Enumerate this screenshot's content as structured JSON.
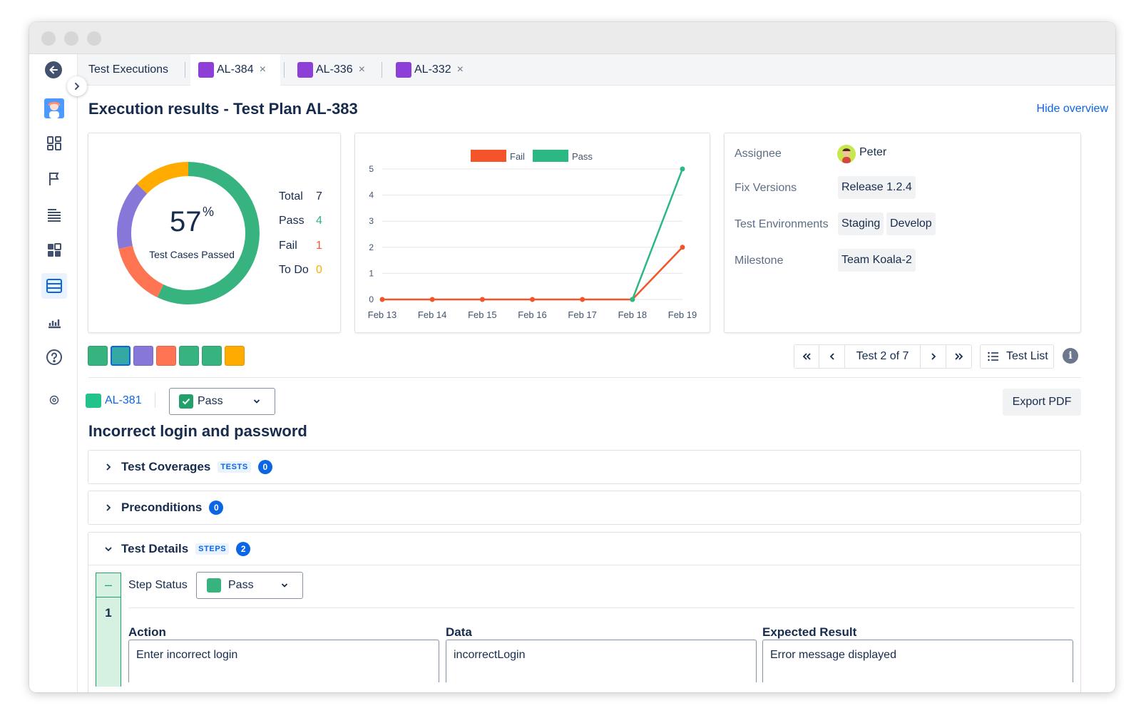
{
  "tabs": {
    "home": "Test Executions",
    "items": [
      {
        "label": "AL-384",
        "close": "×"
      },
      {
        "label": "AL-336",
        "close": "×"
      },
      {
        "label": "AL-332",
        "close": "×"
      }
    ]
  },
  "header": {
    "title": "Execution results - Test Plan AL-383",
    "hide_overview": "Hide overview"
  },
  "summary": {
    "percent": "57",
    "percent_sign": "%",
    "caption": "Test Cases Passed",
    "total_label": "Total",
    "total": "7",
    "pass_label": "Pass",
    "pass": "4",
    "fail_label": "Fail",
    "fail": "1",
    "todo_label": "To Do",
    "todo": "0",
    "colors": {
      "pass": "#36b37e",
      "fail": "#ff7452",
      "todo": "#ffab00",
      "other": "#8777d9"
    }
  },
  "chart_data": {
    "type": "line",
    "x": [
      "Feb 13",
      "Feb 14",
      "Feb 15",
      "Feb 16",
      "Feb 17",
      "Feb 18",
      "Feb 19"
    ],
    "series": [
      {
        "name": "Fail",
        "color": "#f4542a",
        "values": [
          0,
          0,
          0,
          0,
          0,
          0,
          2
        ]
      },
      {
        "name": "Pass",
        "color": "#2bb883",
        "values": [
          null,
          null,
          null,
          null,
          null,
          0,
          5
        ]
      }
    ],
    "ylim": [
      0,
      5
    ],
    "yticks": [
      "0",
      "1",
      "2",
      "3",
      "4",
      "5"
    ],
    "legend": "top",
    "grid": true
  },
  "meta": {
    "assignee_label": "Assignee",
    "assignee": "Peter",
    "fix_versions_label": "Fix Versions",
    "fix_version": "Release 1.2.4",
    "environments_label": "Test Environments",
    "environments": [
      "Staging",
      "Develop"
    ],
    "milestone_label": "Milestone",
    "milestone": "Team Koala-2"
  },
  "run_swatches": [
    "#36b37e",
    "#34a9a4",
    "#8777d9",
    "#ff7452",
    "#36b37e",
    "#36b37e",
    "#ffab00"
  ],
  "pager": {
    "first": "«",
    "prev": "‹",
    "position": "Test 2 of 7",
    "next": "›",
    "last": "»",
    "test_list": "Test List",
    "info": "i"
  },
  "test": {
    "key": "AL-381",
    "status": "Pass",
    "export": "Export PDF",
    "title": "Incorrect login and password"
  },
  "sections": {
    "coverages": {
      "label": "Test Coverages",
      "tag": "TESTS",
      "count": "0"
    },
    "preconditions": {
      "label": "Preconditions",
      "count": "0"
    },
    "details": {
      "label": "Test Details",
      "tag": "STEPS",
      "count": "2"
    }
  },
  "step": {
    "minus": "–",
    "number": "1",
    "status_label": "Step Status",
    "status": "Pass",
    "action_label": "Action",
    "action": "Enter incorrect login",
    "data_label": "Data",
    "data": "incorrectLogin",
    "expected_label": "Expected Result",
    "expected": "Error message displayed"
  }
}
